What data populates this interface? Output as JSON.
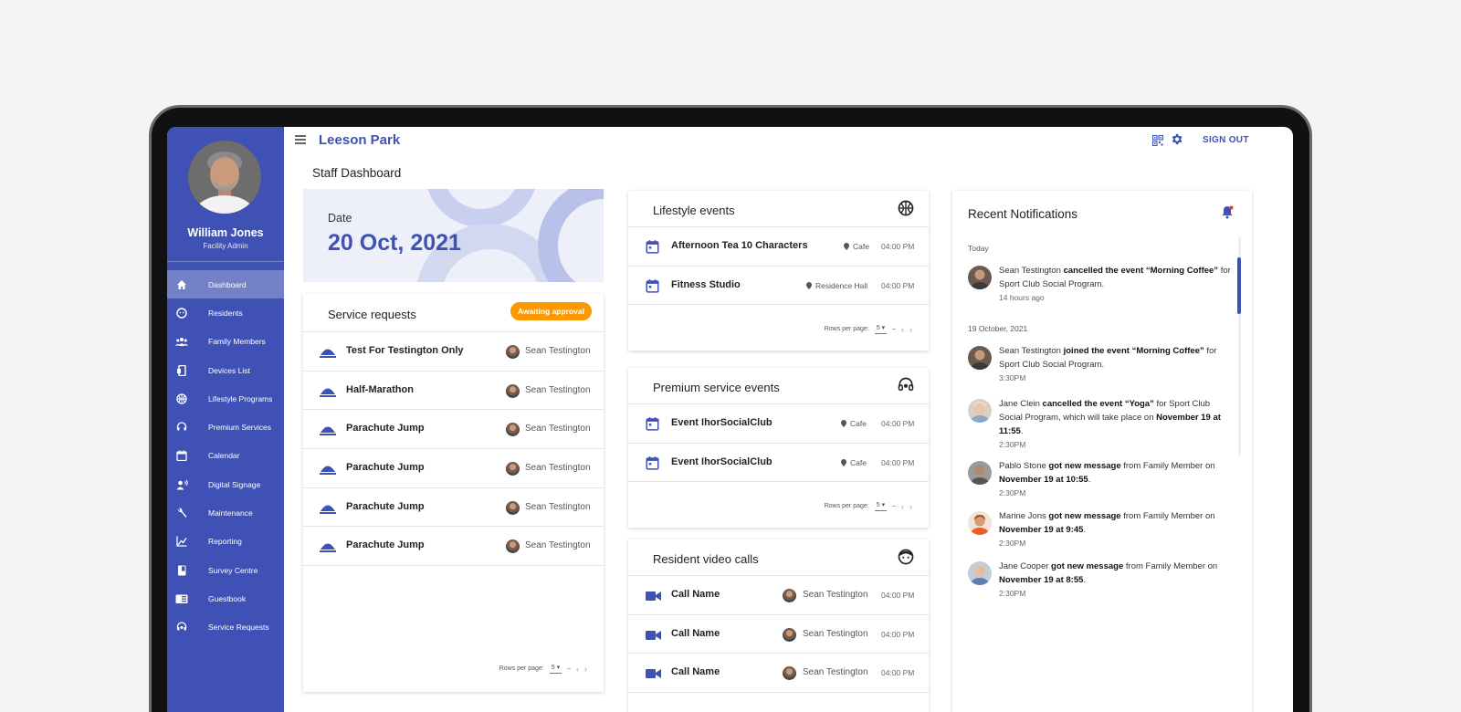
{
  "user": {
    "name": "William Jones",
    "role": "Facility Admin"
  },
  "sidebar": {
    "items": [
      {
        "label": "Dashboard",
        "icon": "home-icon"
      },
      {
        "label": "Residents",
        "icon": "face-icon"
      },
      {
        "label": "Family Members",
        "icon": "people-icon"
      },
      {
        "label": "Devices List",
        "icon": "device-icon"
      },
      {
        "label": "Lifestyle Programs",
        "icon": "basketball-icon"
      },
      {
        "label": "Premium Services",
        "icon": "headset-icon"
      },
      {
        "label": "Calendar",
        "icon": "calendar-icon"
      },
      {
        "label": "Digital Signage",
        "icon": "signage-icon"
      },
      {
        "label": "Maintenance",
        "icon": "wrench-icon"
      },
      {
        "label": "Reporting",
        "icon": "chart-icon"
      },
      {
        "label": "Survey Centre",
        "icon": "survey-icon"
      },
      {
        "label": "Guestbook",
        "icon": "book-icon"
      },
      {
        "label": "Service Requests",
        "icon": "support-icon"
      }
    ]
  },
  "header": {
    "brand": "Leeson Park",
    "signout": "SIGN OUT"
  },
  "page": {
    "title": "Staff Dashboard"
  },
  "date_card": {
    "label": "Date",
    "value": "20 Oct, 2021"
  },
  "service_requests": {
    "title": "Service requests",
    "badge": "Awaiting approval",
    "rows": [
      {
        "title": "Test For Testington Only",
        "person": "Sean Testington"
      },
      {
        "title": "Half-Marathon",
        "person": "Sean Testington"
      },
      {
        "title": "Parachute Jump",
        "person": "Sean Testington"
      },
      {
        "title": "Parachute Jump",
        "person": "Sean Testington"
      },
      {
        "title": "Parachute Jump",
        "person": "Sean Testington"
      },
      {
        "title": "Parachute Jump",
        "person": "Sean Testington"
      }
    ],
    "pager": {
      "label": "Rows per page:",
      "value": "5",
      "range": "–"
    }
  },
  "lifestyle_events": {
    "title": "Lifestyle events",
    "rows": [
      {
        "title": "Afternoon Tea 10 Characters",
        "location": "Cafe",
        "time": "04:00 PM"
      },
      {
        "title": "Fitness Studio",
        "location": "Residence Hall",
        "time": "04:00 PM"
      }
    ],
    "pager": {
      "label": "Rows per page:",
      "value": "5",
      "range": "–"
    }
  },
  "premium_events": {
    "title": "Premium service events",
    "rows": [
      {
        "title": "Event IhorSocialClub",
        "location": "Cafe",
        "time": "04:00 PM"
      },
      {
        "title": "Event IhorSocialClub",
        "location": "Cafe",
        "time": "04:00 PM"
      }
    ],
    "pager": {
      "label": "Rows per page:",
      "value": "5",
      "range": "–"
    }
  },
  "video_calls": {
    "title": "Resident video calls",
    "rows": [
      {
        "title": "Call Name",
        "person": "Sean Testington",
        "time": "04:00 PM"
      },
      {
        "title": "Call Name",
        "person": "Sean Testington",
        "time": "04:00 PM"
      },
      {
        "title": "Call Name",
        "person": "Sean Testington",
        "time": "04:00 PM"
      }
    ]
  },
  "notifications": {
    "title": "Recent Notifications",
    "groups": [
      {
        "date": "Today"
      },
      {
        "date": "19 October, 2021"
      }
    ],
    "items": [
      {
        "pre": "Sean Testington ",
        "bold1": "cancelled the event “Morning Coffee”",
        "mid": " for Sport Club Social Program.",
        "bold2": "",
        "post": "",
        "time": "14 hours ago"
      },
      {
        "pre": "Sean Testington ",
        "bold1": "joined the event “Morning Coffee”",
        "mid": " for Sport Club Social Program.",
        "bold2": "",
        "post": "",
        "time": "3:30PM"
      },
      {
        "pre": "Jane Clein ",
        "bold1": "cancelled the event “Yoga”",
        "mid": " for Sport Club Social Program, which will take place on ",
        "bold2": "November 19 at 11:55",
        "post": ".",
        "time": "2:30PM"
      },
      {
        "pre": "Pablo Stone ",
        "bold1": "got new message",
        "mid": " from Family Member on ",
        "bold2": "November 19 at 10:55",
        "post": ".",
        "time": "2:30PM"
      },
      {
        "pre": "Marine Jons ",
        "bold1": "got new message",
        "mid": " from Family Member on ",
        "bold2": "November 19 at 9:45",
        "post": ".",
        "time": "2:30PM"
      },
      {
        "pre": "Jane Cooper ",
        "bold1": "got new message",
        "mid": " from Family Member on ",
        "bold2": "November 19 at 8:55",
        "post": ".",
        "time": "2:30PM"
      }
    ]
  },
  "colors": {
    "primary": "#3f51b5",
    "accent": "#ff9800",
    "background": "#f4f4f4"
  }
}
